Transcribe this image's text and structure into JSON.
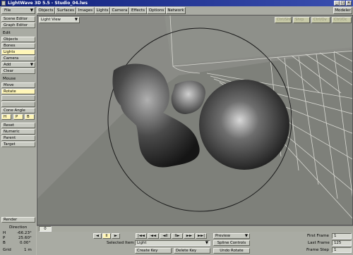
{
  "window": {
    "title": "LightWave 3D 5.5 - Studio_04.lws"
  },
  "menu": {
    "file": "File",
    "tabs": [
      "Objects",
      "Surfaces",
      "Images",
      "Lights",
      "Camera",
      "Effects",
      "Options",
      "Network"
    ],
    "modeler": "Modeler"
  },
  "sidebar": {
    "scene_editor": "Scene Editor",
    "graph_editor": "Graph Editor",
    "edit_label": "Edit",
    "objects": "Objects",
    "bones": "Bones",
    "lights": "Lights",
    "camera": "Camera",
    "add": "Add",
    "clear": "Clear",
    "mouse_label": "Mouse",
    "move": "Move",
    "rotate": "Rotate",
    "cone_angle": "Cone Angle",
    "hpb": [
      "H",
      "P",
      "B"
    ],
    "reset": "Reset",
    "numeric": "Numeric",
    "parent": "Parent",
    "target": "Target",
    "render": "Render",
    "direction_label": "Direction",
    "coords": [
      {
        "axis": "H",
        "value": "-66.23°"
      },
      {
        "axis": "P",
        "value": "25.60°"
      },
      {
        "axis": "B",
        "value": "0.00°"
      }
    ],
    "grid_label": "Grid",
    "grid_value": "1 m"
  },
  "viewport": {
    "view_mode": "Light View",
    "right_buttons": [
      "Ctrl/Shft",
      "Shrp",
      "Ctrl/Ov",
      "Ctrl/Oc"
    ]
  },
  "timeline": {
    "frame": "0"
  },
  "transport": {
    "play_buttons": [
      "◄",
      "II",
      "►"
    ],
    "key_buttons": [
      "|◄◄",
      "◄◄",
      "◄II",
      "II►",
      "►►",
      "►►|"
    ]
  },
  "bottom": {
    "preview": "Preview",
    "selected_item_label": "Selected Item",
    "selected_item_value": "Light",
    "spline_controls": "Spline Controls",
    "create_key": "Create Key",
    "delete_key": "Delete Key",
    "undo_rotate": "Undo Rotate",
    "first_frame_label": "First Frame",
    "first_frame_value": "1",
    "last_frame_label": "Last Frame",
    "last_frame_value": "125",
    "frame_step_label": "Frame Step",
    "frame_step_value": "1"
  },
  "colors": {
    "title_bar": "#10207a",
    "highlight": "#fff6b8",
    "viewport_bg": "#8a8b86"
  }
}
